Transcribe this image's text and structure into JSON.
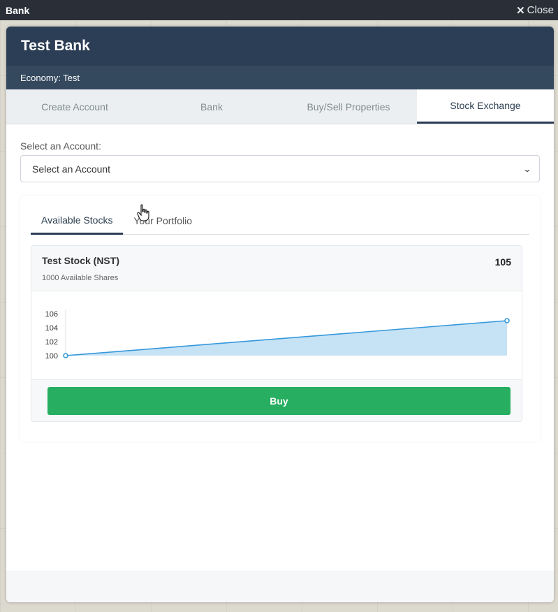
{
  "window": {
    "title": "Bank",
    "close_label": "Close"
  },
  "bank": {
    "title": "Test Bank",
    "economy": "Economy: Test"
  },
  "main_tabs": [
    {
      "label": "Create Account",
      "active": false
    },
    {
      "label": "Bank",
      "active": false
    },
    {
      "label": "Buy/Sell Properties",
      "active": false
    },
    {
      "label": "Stock Exchange",
      "active": true
    }
  ],
  "account": {
    "label": "Select an Account:",
    "selected": "Select an Account"
  },
  "sub_tabs": [
    {
      "label": "Available Stocks",
      "active": true
    },
    {
      "label": "Your Portfolio",
      "active": false
    }
  ],
  "stock": {
    "name": "Test Stock (NST)",
    "shares": "1000 Available Shares",
    "price": "105",
    "buy_label": "Buy"
  },
  "colors": {
    "header": "#2c3e55",
    "buy": "#27ae60",
    "line": "#3498db"
  },
  "chart_data": {
    "type": "area",
    "x": [
      0,
      1
    ],
    "values": [
      100,
      105
    ],
    "ylim": [
      100,
      106
    ],
    "yticks": [
      "100",
      "102",
      "104",
      "106"
    ],
    "grid": false
  }
}
